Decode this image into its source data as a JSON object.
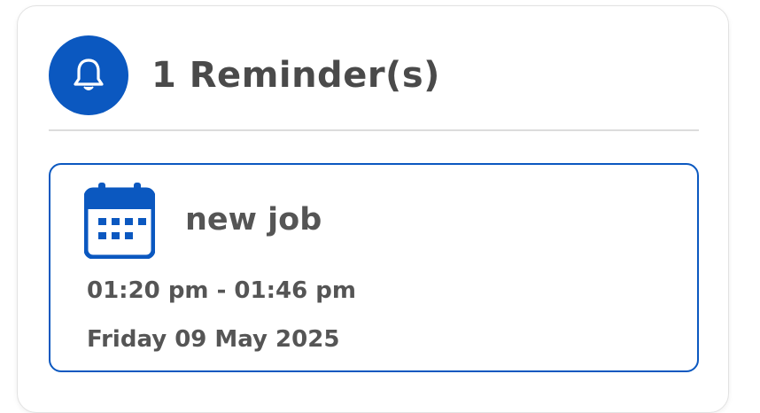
{
  "colors": {
    "accent": "#0b58c0",
    "text": "#4a4a4a",
    "divider": "#dcdcdc"
  },
  "header": {
    "icon": "bell-icon",
    "title": "1 Reminder(s)"
  },
  "reminders": [
    {
      "icon": "calendar-icon",
      "title": "new job",
      "time": "01:20 pm - 01:46 pm",
      "date": "Friday 09 May 2025"
    }
  ]
}
